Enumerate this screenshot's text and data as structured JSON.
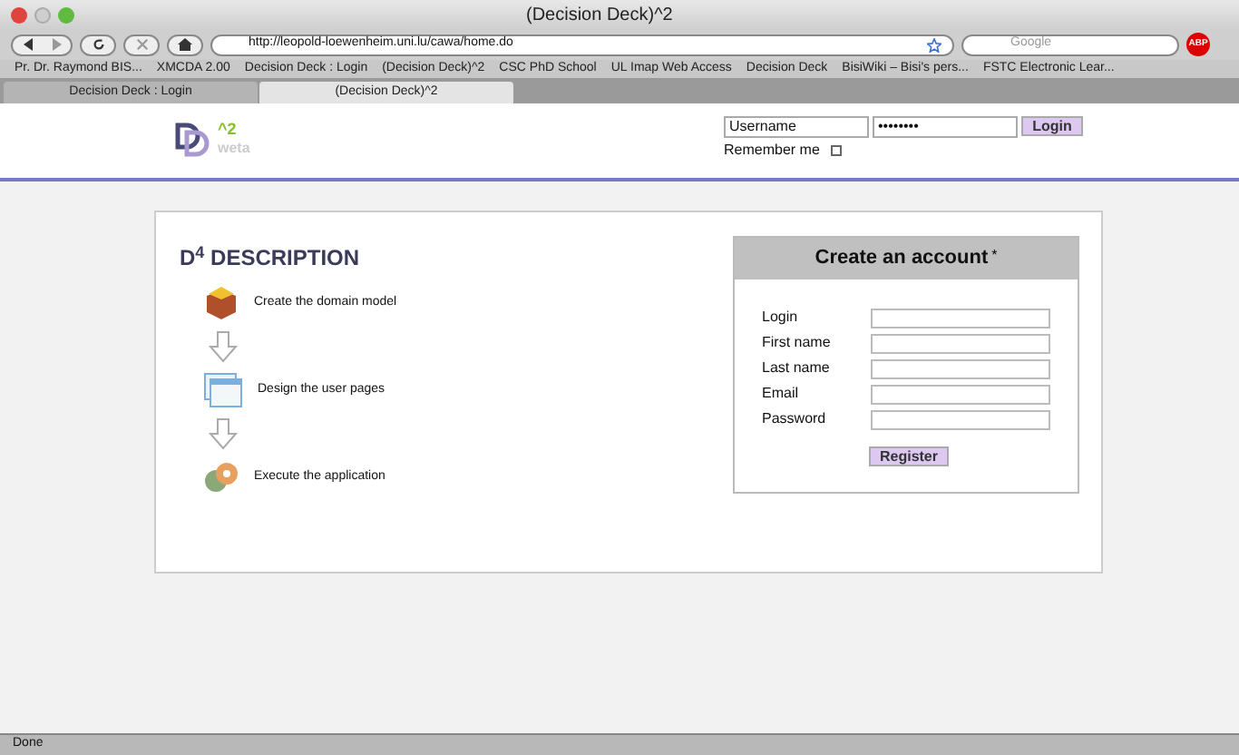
{
  "window": {
    "title": "(Decision Deck)^2"
  },
  "toolbar": {
    "url": "http://leopold-loewenheim.uni.lu/cawa/home.do",
    "search_placeholder": "Google",
    "adblock": "ABP"
  },
  "bookmarks": [
    "Pr. Dr. Raymond BIS...",
    "XMCDA 2.00",
    "Decision Deck : Login",
    "(Decision Deck)^2",
    "CSC PhD School",
    "UL Imap Web Access",
    "Decision Deck",
    "BisiWiki – Bisi's pers...",
    "FSTC Electronic Lear..."
  ],
  "tabs": [
    {
      "label": "Decision Deck : Login",
      "selected": false
    },
    {
      "label": "(Decision Deck)^2",
      "selected": true
    }
  ],
  "header": {
    "logo_sup": "^2",
    "logo_sub": "weta",
    "username": "Username",
    "password": "••••••••",
    "login": "Login",
    "remember": "Remember me",
    "remember_checked": false
  },
  "description": {
    "title": "D$^{4}$ DESCRIPTION",
    "steps": [
      {
        "kind": "box",
        "label": "Create the domain model"
      },
      {
        "kind": "window",
        "label": "Design the user pages"
      },
      {
        "kind": "gears",
        "label": "Execute the application"
      }
    ]
  },
  "account": {
    "title": "Create an account",
    "mark": "*",
    "fields": [
      "Login",
      "First name",
      "Last name",
      "Email",
      "Password"
    ],
    "button": "Register"
  },
  "status_bar": "Done"
}
